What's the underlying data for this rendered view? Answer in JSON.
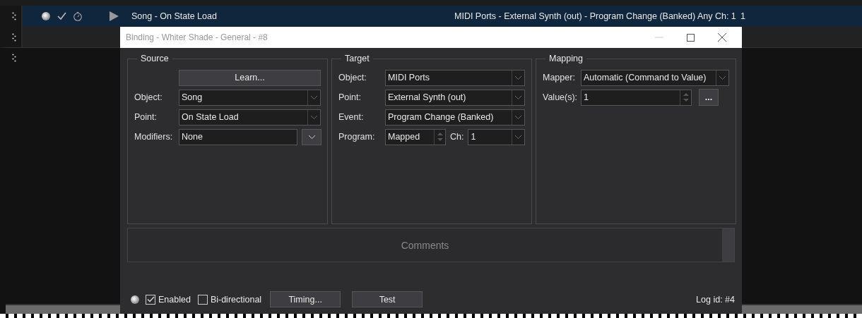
{
  "bindings": [
    {
      "selected": true,
      "enabled": true,
      "name": "Song - On State Load",
      "target": "MIDI Ports - External Synth (out) - Program Change (Banked) Any Ch: 1",
      "column_4": "1"
    }
  ],
  "dialog": {
    "title": "Binding - Whiter Shade - General - #8",
    "groups": [
      {
        "title": "Source",
        "learn_button": "Learn...",
        "fields": [
          {
            "label": "Object:",
            "controls": [
              {
                "kind": "dropdown",
                "value": "Song"
              }
            ]
          },
          {
            "label": "Point:",
            "controls": [
              {
                "kind": "dropdown",
                "value": "On State Load"
              }
            ]
          },
          {
            "label": "Modifiers:",
            "controls": [
              {
                "kind": "combo",
                "value": "None"
              }
            ]
          }
        ]
      },
      {
        "title": "Target",
        "fields": [
          {
            "label": "Object:",
            "controls": [
              {
                "kind": "dropdown",
                "value": "MIDI Ports"
              }
            ]
          },
          {
            "label": "Point:",
            "controls": [
              {
                "kind": "dropdown",
                "value": "External Synth (out)"
              }
            ]
          },
          {
            "label": "Event:",
            "controls": [
              {
                "kind": "dropdown",
                "value": "Program Change (Banked)"
              }
            ]
          },
          {
            "label": "Program:",
            "controls": [
              {
                "kind": "spin",
                "value": "Mapped"
              },
              {
                "kind": "label",
                "value": "Ch:"
              },
              {
                "kind": "dropdown",
                "value": "1"
              }
            ]
          }
        ]
      },
      {
        "title": "Mapping",
        "fields": [
          {
            "label": "Mapper:",
            "controls": [
              {
                "kind": "dropdown",
                "value": "Automatic (Command to Value)"
              }
            ]
          },
          {
            "label": "Value(s):",
            "controls": [
              {
                "kind": "spin",
                "value": "1"
              },
              {
                "kind": "button",
                "value": "..."
              }
            ]
          }
        ]
      }
    ],
    "comments": {
      "placeholder": "Comments"
    },
    "footer": {
      "enabled": {
        "label": "Enabled",
        "checked": true
      },
      "bidirectional": {
        "label": "Bi-directional",
        "checked": false
      },
      "buttons": [
        "Timing...",
        "Test"
      ],
      "log_id": "Log id: #4"
    }
  }
}
